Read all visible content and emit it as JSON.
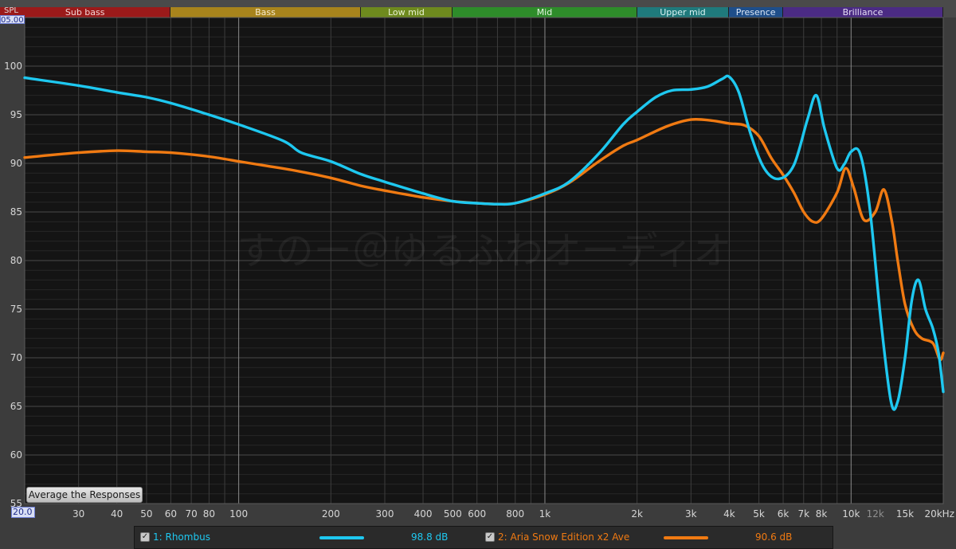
{
  "bands": [
    {
      "label": "Sub bass",
      "from": 20,
      "to": 60,
      "bg": "#9b1a1a",
      "fg": "#f3d6d6"
    },
    {
      "label": "Bass",
      "from": 60,
      "to": 250,
      "bg": "#a8841c",
      "fg": "#f7eccf"
    },
    {
      "label": "Low mid",
      "from": 250,
      "to": 500,
      "bg": "#6e8a1e",
      "fg": "#e9f2d2"
    },
    {
      "label": "Mid",
      "from": 500,
      "to": 2000,
      "bg": "#2e8c2a",
      "fg": "#e3f5e1"
    },
    {
      "label": "Upper mid",
      "from": 2000,
      "to": 4000,
      "bg": "#1f7a7c",
      "fg": "#d9f2f2"
    },
    {
      "label": "Presence",
      "from": 4000,
      "to": 6000,
      "bg": "#1e4e8a",
      "fg": "#dae6f6"
    },
    {
      "label": "Brilliance",
      "from": 6000,
      "to": 20000,
      "bg": "#4b2b84",
      "fg": "#e6def5"
    }
  ],
  "axis": {
    "y_label": "SPL",
    "y_top_value": "05.00",
    "x_start_value": "20.0"
  },
  "watermark": "すのー＠ゆるふわオーディオ",
  "average_button_label": "Average the Responses",
  "legend": [
    {
      "check": "✓",
      "name": "1: Rhombus",
      "value": "98.8 dB",
      "color": "#1ec8f0"
    },
    {
      "check": "✓",
      "name": "2: Aria Snow Edition x2 Ave",
      "value": "90.6 dB",
      "color": "#f07a12"
    }
  ],
  "chart_data": {
    "type": "line",
    "xscale": "log",
    "xlim": [
      20,
      20000
    ],
    "ylim": [
      55,
      105
    ],
    "grid": true,
    "xlabel": "",
    "ylabel": "SPL",
    "y_ticks": [
      "55",
      "60",
      "65",
      "70",
      "75",
      "80",
      "85",
      "90",
      "95",
      "100"
    ],
    "y_tick_values": [
      55,
      60,
      65,
      70,
      75,
      80,
      85,
      90,
      95,
      100
    ],
    "x_ticks": [
      "30",
      "40",
      "50",
      "60",
      "70",
      "80",
      "100",
      "200",
      "300",
      "400",
      "500",
      "600",
      "800",
      "1k",
      "2k",
      "3k",
      "4k",
      "5k",
      "6k",
      "7k",
      "8k",
      "10k",
      "12k",
      "15k",
      "20kHz"
    ],
    "x_tick_values": [
      30,
      40,
      50,
      60,
      70,
      80,
      100,
      200,
      300,
      400,
      500,
      600,
      800,
      1000,
      2000,
      3000,
      4000,
      5000,
      6000,
      7000,
      8000,
      10000,
      12000,
      15000,
      20000
    ],
    "series": [
      {
        "name": "1: Rhombus",
        "color": "#1ec8f0",
        "x": [
          20,
          30,
          40,
          50,
          60,
          80,
          100,
          140,
          160,
          200,
          250,
          300,
          400,
          500,
          600,
          700,
          800,
          1000,
          1200,
          1500,
          1800,
          2000,
          2300,
          2600,
          3000,
          3400,
          3800,
          4000,
          4300,
          4700,
          5200,
          5800,
          6500,
          7200,
          7700,
          8200,
          9000,
          9500,
          10000,
          10700,
          11500,
          12500,
          13500,
          14200,
          15000,
          15800,
          16600,
          17500,
          18500,
          19300,
          20000
        ],
        "y": [
          98.8,
          98.0,
          97.3,
          96.8,
          96.2,
          95.0,
          94.0,
          92.3,
          91.1,
          90.2,
          88.9,
          88.1,
          86.9,
          86.1,
          85.9,
          85.8,
          85.9,
          86.9,
          88.1,
          91.0,
          94.0,
          95.3,
          96.8,
          97.5,
          97.6,
          97.9,
          98.7,
          98.9,
          97.3,
          93.0,
          89.5,
          88.4,
          89.8,
          94.5,
          97.0,
          93.5,
          89.5,
          89.9,
          91.2,
          91.0,
          85.5,
          74.0,
          65.5,
          65.5,
          70.0,
          76.0,
          78.0,
          75.0,
          73.0,
          70.5,
          66.5
        ]
      },
      {
        "name": "2: Aria Snow Edition x2 Ave",
        "color": "#f07a12",
        "x": [
          20,
          30,
          40,
          50,
          60,
          80,
          100,
          120,
          150,
          200,
          250,
          300,
          400,
          500,
          600,
          700,
          800,
          1000,
          1200,
          1500,
          1800,
          2000,
          2500,
          3000,
          3500,
          4000,
          4500,
          5000,
          5500,
          6000,
          6500,
          7000,
          7500,
          8000,
          9000,
          9600,
          10200,
          11000,
          12000,
          12800,
          13600,
          14200,
          15000,
          16000,
          17000,
          18500,
          19500,
          20000
        ],
        "y": [
          90.6,
          91.1,
          91.3,
          91.2,
          91.1,
          90.7,
          90.2,
          89.8,
          89.3,
          88.5,
          87.7,
          87.2,
          86.5,
          86.1,
          85.9,
          85.8,
          85.9,
          86.8,
          88.0,
          90.2,
          91.8,
          92.4,
          93.8,
          94.5,
          94.4,
          94.1,
          93.9,
          92.8,
          90.5,
          88.8,
          87.0,
          85.0,
          84.0,
          84.3,
          87.0,
          89.5,
          87.5,
          84.2,
          85.0,
          87.3,
          84.0,
          80.0,
          75.5,
          73.0,
          72.0,
          71.5,
          69.8,
          70.5
        ]
      }
    ]
  }
}
